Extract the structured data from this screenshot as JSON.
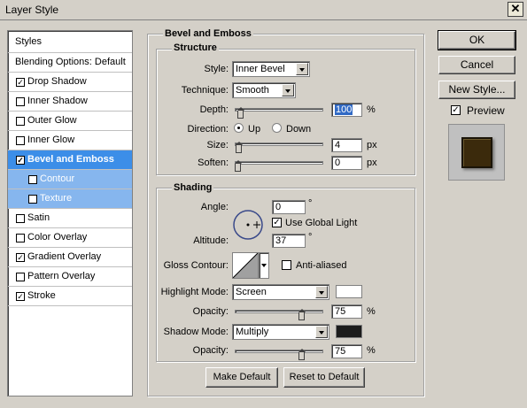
{
  "window": {
    "title": "Layer Style",
    "close_glyph": "✕"
  },
  "styles_list": {
    "header": "Styles",
    "blending": "Blending Options: Default",
    "items": [
      {
        "label": "Drop Shadow",
        "checked": true
      },
      {
        "label": "Inner Shadow",
        "checked": false
      },
      {
        "label": "Outer Glow",
        "checked": false
      },
      {
        "label": "Inner Glow",
        "checked": false
      },
      {
        "label": "Bevel and Emboss",
        "checked": true
      },
      {
        "label": "Contour",
        "checked": false
      },
      {
        "label": "Texture",
        "checked": false
      },
      {
        "label": "Satin",
        "checked": false
      },
      {
        "label": "Color Overlay",
        "checked": false
      },
      {
        "label": "Gradient Overlay",
        "checked": true
      },
      {
        "label": "Pattern Overlay",
        "checked": false
      },
      {
        "label": "Stroke",
        "checked": true
      }
    ]
  },
  "bevel": {
    "title": "Bevel and Emboss",
    "structure": {
      "title": "Structure",
      "style_label": "Style:",
      "style_value": "Inner Bevel",
      "technique_label": "Technique:",
      "technique_value": "Smooth",
      "depth_label": "Depth:",
      "depth_value": "100",
      "depth_unit": "%",
      "direction_label": "Direction:",
      "dir_up": "Up",
      "dir_down": "Down",
      "size_label": "Size:",
      "size_value": "4",
      "size_unit": "px",
      "soften_label": "Soften:",
      "soften_value": "0",
      "soften_unit": "px"
    },
    "shading": {
      "title": "Shading",
      "angle_label": "Angle:",
      "angle_value": "0",
      "angle_unit": "°",
      "global_light_label": "Use Global Light",
      "global_light_checked": true,
      "altitude_label": "Altitude:",
      "altitude_value": "37",
      "altitude_unit": "°",
      "gloss_label": "Gloss Contour:",
      "anti_aliased_label": "Anti-aliased",
      "highlight_label": "Highlight Mode:",
      "highlight_value": "Screen",
      "highlight_color": "#ffffff",
      "hl_opacity_label": "Opacity:",
      "hl_opacity_value": "75",
      "hl_opacity_unit": "%",
      "shadow_label": "Shadow Mode:",
      "shadow_value": "Multiply",
      "shadow_color": "#1c1c1c",
      "sh_opacity_label": "Opacity:",
      "sh_opacity_value": "75",
      "sh_opacity_unit": "%"
    },
    "make_default": "Make Default",
    "reset_default": "Reset to Default"
  },
  "buttons": {
    "ok": "OK",
    "cancel": "Cancel",
    "new_style": "New Style...",
    "preview": "Preview"
  },
  "preview": {
    "checked": true,
    "swatch_color": "#3b2a0c"
  },
  "colors": {
    "selected": "#3c8ee8",
    "sub_selected": "#86b6ee"
  }
}
